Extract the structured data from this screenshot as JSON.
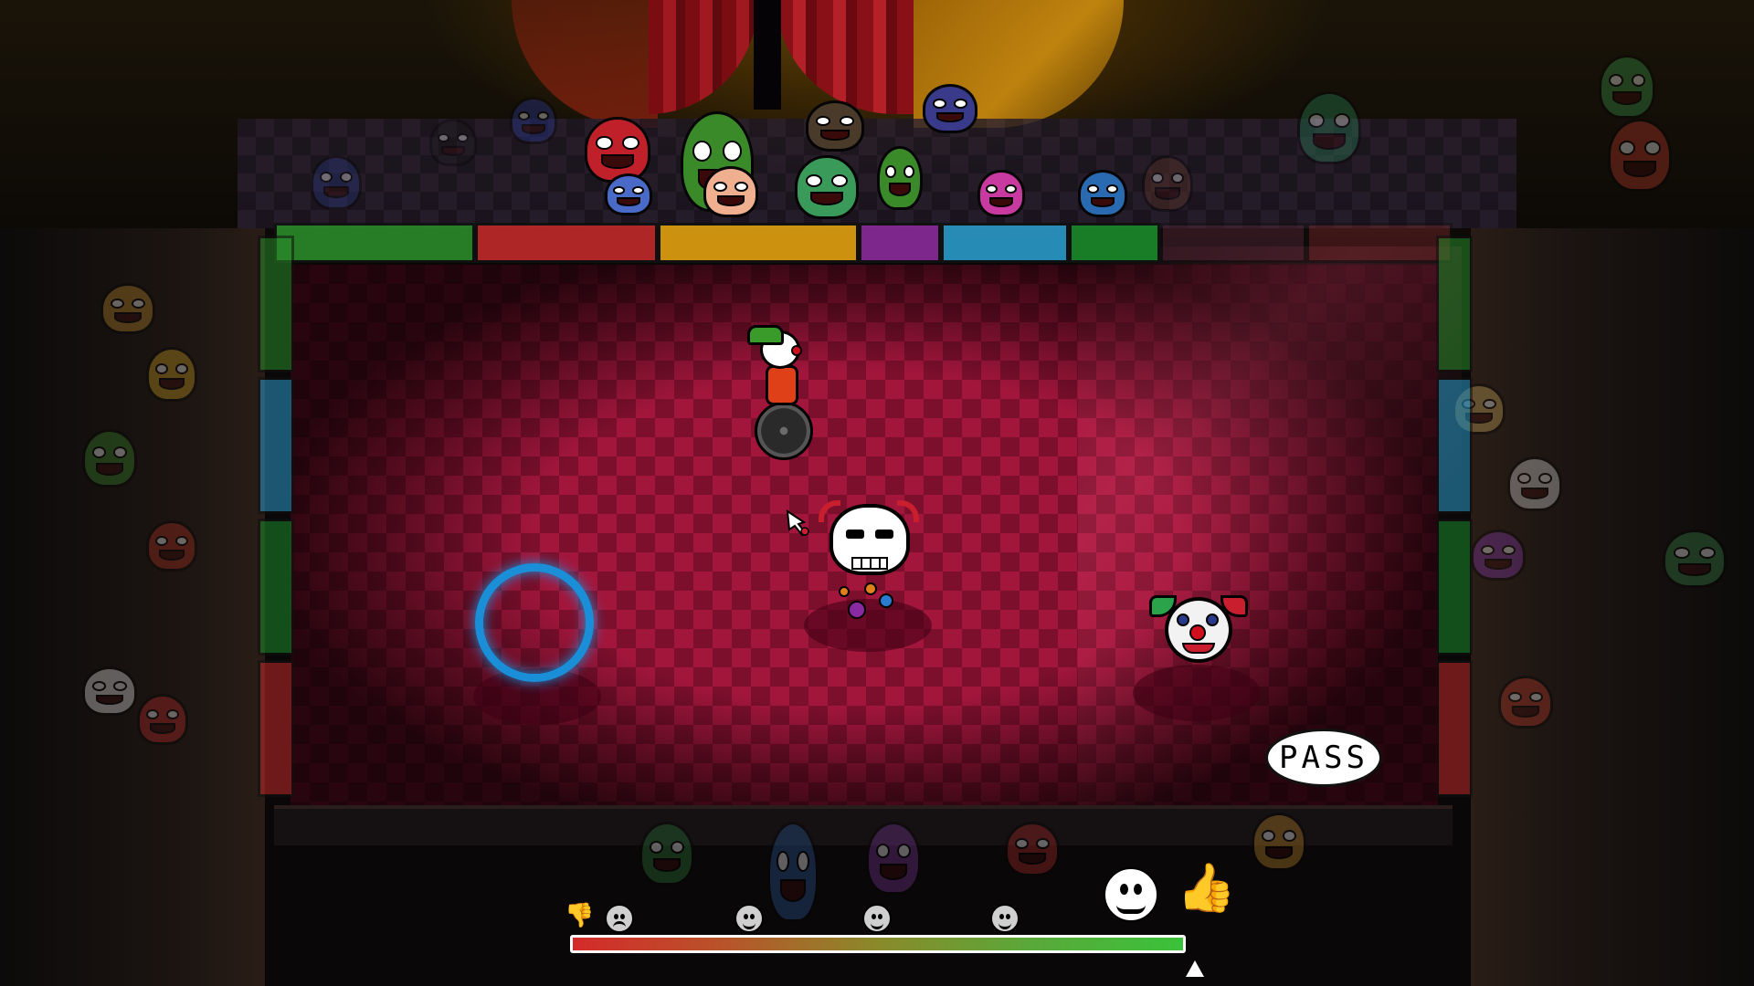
{
  "pass_label": "PASS",
  "hud": {
    "crowd_mood": 1.0,
    "mood_faces": [
      "sad",
      "neutral",
      "neutral",
      "neutral",
      "neutral"
    ],
    "mood_gradient": [
      "#d42a2a",
      "#b8542a",
      "#8a8a2a",
      "#5aa83a",
      "#3ac23a"
    ],
    "thumb_down_icon": "thumb-down-icon",
    "thumb_up_icon": "thumb-up-icon"
  },
  "colors": {
    "floor_light": "#a3163c",
    "floor_dark": "#7c0f2c",
    "target_ring": "#1a8fd8",
    "barrier_segments": [
      "#2a8a2a",
      "#c02a2a",
      "#e0a010",
      "#8a2a9a",
      "#2a9ac8",
      "#1a8a2a",
      "#5a2a3a",
      "#7a2a2a"
    ]
  }
}
